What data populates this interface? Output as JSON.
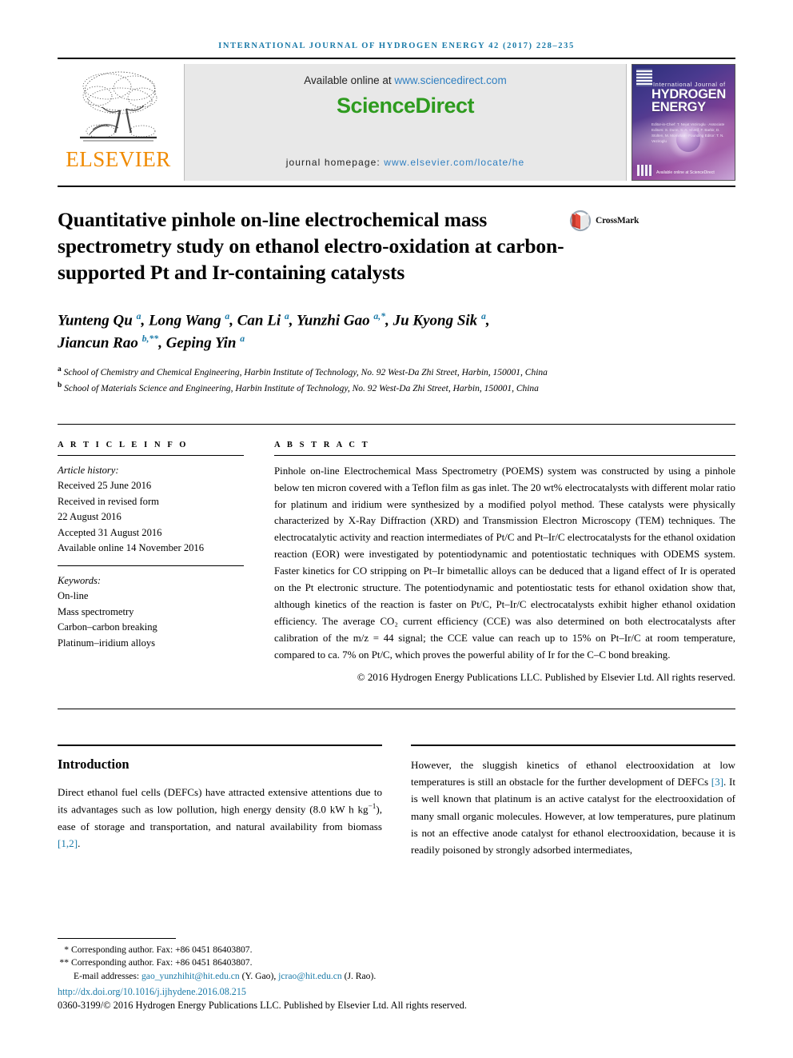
{
  "running_head": "INTERNATIONAL JOURNAL OF HYDROGEN ENERGY 42 (2017) 228–235",
  "masthead": {
    "publisher_name": "ELSEVIER",
    "publisher_logo": "elsevier-tree-logo",
    "available_prefix": "Available online at ",
    "available_url": "www.sciencedirect.com",
    "sciencedirect_part1": "Science",
    "sciencedirect_part2": "Direct",
    "homepage_prefix": "journal homepage: ",
    "homepage_url": "www.elsevier.com/locate/he",
    "cover": {
      "small_title": "International Journal of",
      "big_title_line1": "HYDROGEN",
      "big_title_line2": "ENERGY",
      "editors": "Editor-in-Chief: T. Nejat Veziroglu · Associate Editors: S. Dunn, S. A. Sherif, F. Barbir, D. Stolten, M. Momirlan · Founding Editor: T. N. Veziroglu",
      "footer_text": "Available online at ScienceDirect"
    }
  },
  "article": {
    "title": "Quantitative pinhole on-line electrochemical mass spectrometry study on ethanol electro-oxidation at carbon-supported Pt and Ir-containing catalysts",
    "crossmark_label": "CrossMark",
    "crossmark_icon": "crossmark-icon",
    "authors_line1": "Yunteng Qu <sup>a</sup>, Long Wang <sup>a</sup>, Can Li <sup>a</sup>, Yunzhi Gao <sup>a,*</sup>, Ju Kyong Sik <sup>a</sup>,",
    "authors_line2": "Jiancun Rao <sup>b,**</sup>, Geping Yin <sup>a</sup>",
    "affiliation_a": "<sup>a</sup> School of Chemistry and Chemical Engineering, Harbin Institute of Technology, No. 92 West-Da Zhi Street, Harbin, 150001, China",
    "affiliation_b": "<sup>b</sup> School of Materials Science and Engineering, Harbin Institute of Technology, No. 92 West-Da Zhi Street, Harbin, 150001, China"
  },
  "info": {
    "heading": "A R T I C L E   I N F O",
    "history_label": "Article history:",
    "history": [
      "Received 25 June 2016",
      "Received in revised form",
      "22 August 2016",
      "Accepted 31 August 2016",
      "Available online 14 November 2016"
    ],
    "keywords_label": "Keywords:",
    "keywords": [
      "On-line",
      "Mass spectrometry",
      "Carbon–carbon breaking",
      "Platinum–iridium alloys"
    ]
  },
  "abstract": {
    "heading": "A B S T R A C T",
    "body": "Pinhole on-line Electrochemical Mass Spectrometry (POEMS) system was constructed by using a pinhole below ten micron covered with a Teflon film as gas inlet. The 20 wt% electrocatalysts with different molar ratio for platinum and iridium were synthesized by a modified polyol method. These catalysts were physically characterized by X-Ray Diffraction (XRD) and Transmission Electron Microscopy (TEM) techniques. The electrocatalytic activity and reaction intermediates of Pt/C and Pt–Ir/C electrocatalysts for the ethanol oxidation reaction (EOR) were investigated by potentiodynamic and potentiostatic techniques with ODEMS system. Faster kinetics for CO stripping on Pt–Ir bimetallic alloys can be deduced that a ligand effect of Ir is operated on the Pt electronic structure. The potentiodynamic and potentiostatic tests for ethanol oxidation show that, although kinetics of the reaction is faster on Pt/C, Pt–Ir/C electrocatalysts exhibit higher ethanol oxidation efficiency. The average CO₂ current efficiency (CCE) was also determined on both electrocatalysts after calibration of the m/z = 44 signal; the CCE value can reach up to 15% on Pt–Ir/C at room temperature, compared to ca. 7% on Pt/C, which proves the powerful ability of Ir for the C–C bond breaking.",
    "copyright": "© 2016 Hydrogen Energy Publications LLC. Published by Elsevier Ltd. All rights reserved."
  },
  "introduction": {
    "title": "Introduction",
    "left_paragraph_html": "Direct ethanol fuel cells (DEFCs) have attracted extensive attentions due to its advantages such as low pollution, high energy density (8.0 kW h kg<sup class=\"num\">−1</sup>), ease of storage and transportation, and natural availability from biomass <span class=\"ref\">[1,2]</span>.",
    "right_paragraph_html": "However, the sluggish kinetics of ethanol electrooxidation at low temperatures is still an obstacle for the further development of DEFCs <span class=\"ref\">[3]</span>. It is well known that platinum is an active catalyst for the electrooxidation of many small organic molecules. However, at low temperatures, pure platinum is not an effective anode catalyst for ethanol electrooxidation, because it is readily poisoned by strongly adsorbed intermediates,"
  },
  "footnotes": {
    "corresponding_1": "Corresponding author. Fax: +86 0451 86403807.",
    "corresponding_1_marker": "*",
    "corresponding_2": "Corresponding author. Fax: +86 0451 86403807.",
    "corresponding_2_marker": "**",
    "email_label": "E-mail addresses: ",
    "email_1": "gao_yunzhihit@hit.edu.cn",
    "email_1_owner": " (Y. Gao), ",
    "email_2": "jcrao@hit.edu.cn",
    "email_2_owner": " (J. Rao).",
    "doi": "http://dx.doi.org/10.1016/j.ijhydene.2016.08.215",
    "issn_line": "0360-3199/© 2016 Hydrogen Energy Publications LLC. Published by Elsevier Ltd. All rights reserved."
  },
  "colors": {
    "link_blue": "#1a7aa8",
    "sciencedirect_green": "#2e9b1f",
    "elsevier_orange": "#f08a00",
    "url_blue": "#2f7fc1"
  }
}
